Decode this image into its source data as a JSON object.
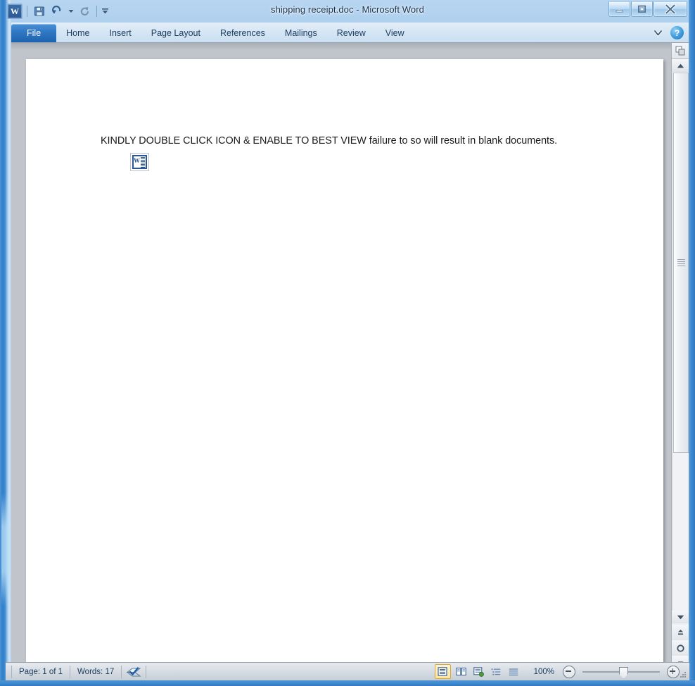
{
  "window": {
    "title": "shipping receipt.doc  -  Microsoft Word",
    "minimize_label": "–",
    "maximize_label": "❐",
    "close_label": "✕"
  },
  "quick_access": {
    "app_logo_label": "W",
    "save_label": "Save",
    "undo_label": "Undo",
    "redo_label": "Redo",
    "customize_label": "Customize Quick Access Toolbar"
  },
  "ribbon": {
    "tabs": [
      {
        "label": "File",
        "active": true
      },
      {
        "label": "Home",
        "active": false
      },
      {
        "label": "Insert",
        "active": false
      },
      {
        "label": "Page Layout",
        "active": false
      },
      {
        "label": "References",
        "active": false
      },
      {
        "label": "Mailings",
        "active": false
      },
      {
        "label": "Review",
        "active": false
      },
      {
        "label": "View",
        "active": false
      }
    ],
    "minimize_ribbon_label": "⌄",
    "help_label": "?"
  },
  "document": {
    "body_text": "KINDLY DOUBLE CLICK ICON & ENABLE TO BEST VIEW failure to so will result in blank documents.",
    "embedded_object_label": "W"
  },
  "scrollbar": {
    "ruler_toggle_label": "View Ruler",
    "up_arrow": "▲",
    "down_arrow": "▼",
    "previous_page": "Previous Page",
    "select_browse_object": "Select Browse Object",
    "next_page": "Next Page"
  },
  "status_bar": {
    "page_label": "Page: 1 of 1",
    "words_label": "Words: 17",
    "proofing_label": "Proofing errors",
    "views": [
      {
        "name": "print-layout",
        "active": true
      },
      {
        "name": "full-screen-reading",
        "active": false
      },
      {
        "name": "web-layout",
        "active": false
      },
      {
        "name": "outline",
        "active": false
      },
      {
        "name": "draft",
        "active": false
      }
    ],
    "zoom_label": "100%",
    "zoom_out_label": "Zoom Out",
    "zoom_in_label": "Zoom In"
  },
  "colors": {
    "accent_blue": "#2f77c4",
    "word_icon_blue": "#2b579a",
    "active_view_border": "#e0a62b",
    "page_background": "#ffffff",
    "workspace_gray": "#c1c5cb"
  }
}
